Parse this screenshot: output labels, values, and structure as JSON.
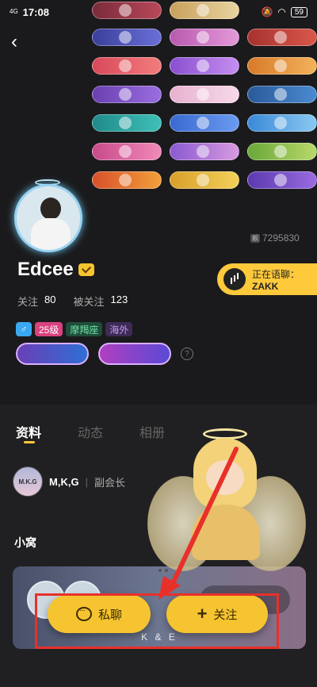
{
  "status": {
    "signal": "4G",
    "time": "17:08",
    "battery": "59"
  },
  "badges": [
    [
      "",
      "",
      ""
    ],
    [
      "",
      "",
      ""
    ],
    [
      "",
      "",
      ""
    ],
    [
      "",
      "",
      ""
    ],
    [
      "",
      "",
      ""
    ],
    [
      "",
      "",
      ""
    ],
    [
      "",
      "",
      ""
    ]
  ],
  "profile": {
    "uid_tag": "靓",
    "uid": "7295830",
    "name": "Edcee",
    "following_label": "关注",
    "following_count": "80",
    "followers_label": "被关注",
    "followers_count": "123"
  },
  "voice": {
    "status": "正在语聊：",
    "room": "ZAKK"
  },
  "tags": {
    "gender": "♂",
    "level": "25级",
    "zodiac": "摩羯座",
    "region": "海外"
  },
  "honors": [
    "",
    ""
  ],
  "help": "?",
  "tabs": [
    "资料",
    "动态",
    "相册"
  ],
  "guild": {
    "logo": "M.K.G",
    "name": "M,K,G",
    "separator": "|",
    "role": "副会长"
  },
  "section": {
    "nest_title": "小窝"
  },
  "nest": {
    "badge": "",
    "name": "K & E"
  },
  "actions": {
    "chat": "私聊",
    "follow": "关注"
  },
  "colors": {
    "accent": "#f5c430",
    "highlight": "#e8302a",
    "background": "#1a1a1c"
  }
}
